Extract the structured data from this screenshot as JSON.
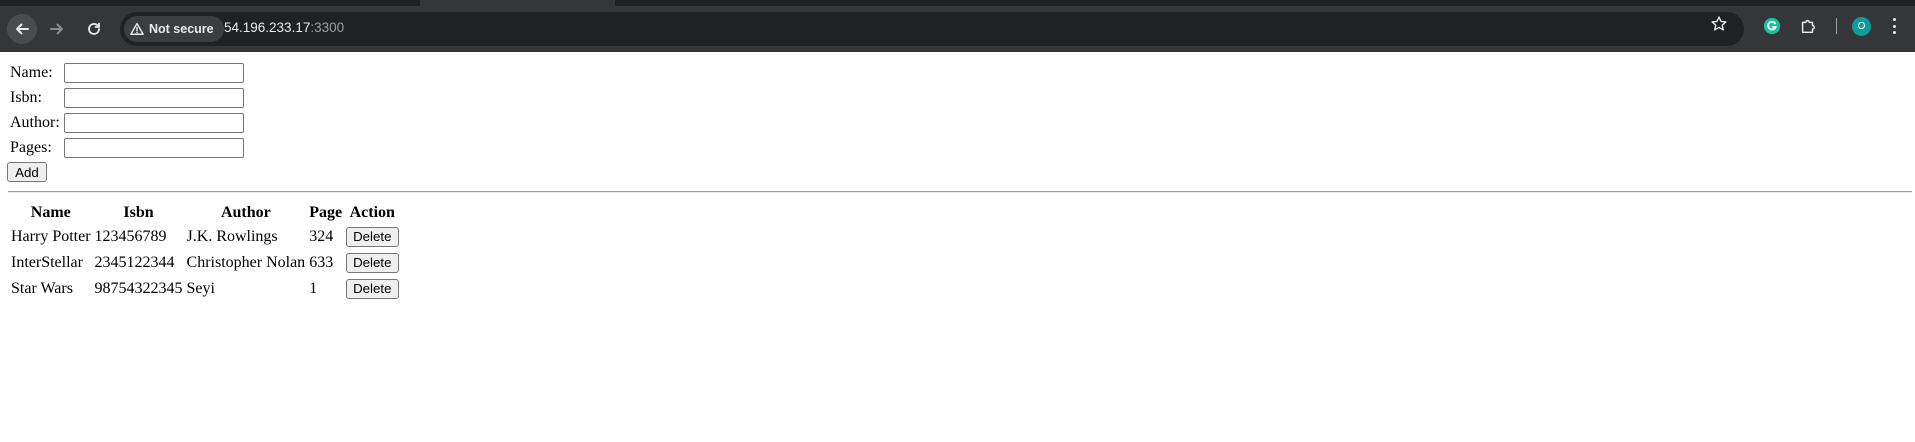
{
  "browser": {
    "security_label": "Not secure",
    "url_host": "54.196.233.17",
    "url_port": ":3300",
    "profile_initial": "O",
    "icons": {
      "back": "arrow-left-icon",
      "forward": "arrow-right-icon",
      "reload": "reload-icon",
      "security": "warning-triangle-icon",
      "bookmark": "star-icon",
      "grammarly": "grammarly-icon",
      "extensions": "puzzle-icon",
      "menu": "kebab-menu-icon"
    },
    "colors": {
      "toolbar": "#35363a",
      "omnibox": "#202124",
      "avatar": "#0d9c9a",
      "grammarly": "#15c39a"
    }
  },
  "form": {
    "name_label": "Name:",
    "isbn_label": "Isbn:",
    "author_label": "Author:",
    "pages_label": "Pages:",
    "name_value": "",
    "isbn_value": "",
    "author_value": "",
    "pages_value": "",
    "add_label": "Add"
  },
  "table": {
    "headers": [
      "Name",
      "Isbn",
      "Author",
      "Page",
      "Action"
    ],
    "rows": [
      {
        "name": "Harry Potter",
        "isbn": "123456789",
        "author": "J.K. Rowlings",
        "page": "324",
        "action": "Delete"
      },
      {
        "name": "InterStellar",
        "isbn": "2345122344",
        "author": "Christopher Nolan",
        "page": "633",
        "action": "Delete"
      },
      {
        "name": "Star Wars",
        "isbn": "98754322345",
        "author": "Seyi",
        "page": "1",
        "action": "Delete"
      }
    ]
  }
}
